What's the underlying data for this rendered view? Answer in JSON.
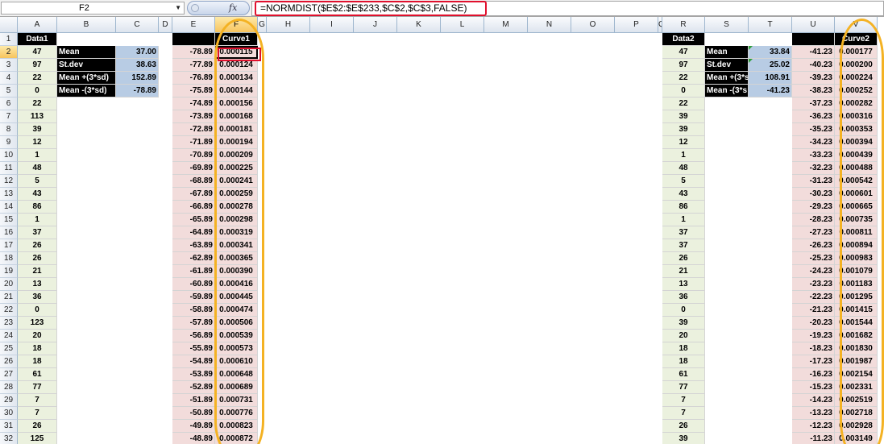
{
  "formula_bar": {
    "name_box": "F2",
    "fx_label": "fx",
    "formula": "=NORMDIST($E$2:$E$233,$C$2,$C$3,FALSE)"
  },
  "columns": [
    "A",
    "B",
    "C",
    "D",
    "E",
    "F",
    "G",
    "H",
    "I",
    "J",
    "K",
    "L",
    "M",
    "N",
    "O",
    "P",
    "Q",
    "R",
    "S",
    "T",
    "U",
    "V"
  ],
  "active_column": "F",
  "active_row": 2,
  "rows": [
    1,
    2,
    3,
    4,
    5,
    6,
    7,
    8,
    9,
    10,
    11,
    12,
    13,
    14,
    15,
    16,
    17,
    18,
    19,
    20,
    21,
    22,
    23,
    24,
    25,
    26,
    27,
    28,
    29,
    30,
    31,
    32
  ],
  "headers": {
    "A1": "Data1",
    "F1": "Curve1",
    "R1": "Data2",
    "V1": "Curve2"
  },
  "stats_left": [
    {
      "label": "Mean",
      "value": "37.00"
    },
    {
      "label": "St.dev",
      "value": "38.63"
    },
    {
      "label": "Mean +(3*sd)",
      "value": "152.89"
    },
    {
      "label": "Mean -(3*sd)",
      "value": "-78.89"
    }
  ],
  "stats_right": [
    {
      "label": "Mean",
      "value": "33.84"
    },
    {
      "label": "St.dev",
      "value": "25.02"
    },
    {
      "label": "Mean +(3*s",
      "value": "108.91"
    },
    {
      "label": "Mean -(3*s",
      "value": "-41.23"
    }
  ],
  "col_A": [
    "47",
    "97",
    "22",
    "0",
    "22",
    "113",
    "39",
    "12",
    "1",
    "48",
    "5",
    "43",
    "86",
    "1",
    "37",
    "26",
    "26",
    "21",
    "13",
    "36",
    "0",
    "123",
    "20",
    "18",
    "18",
    "61",
    "77",
    "7",
    "7",
    "26",
    "125"
  ],
  "col_E": [
    "-78.89",
    "-77.89",
    "-76.89",
    "-75.89",
    "-74.89",
    "-73.89",
    "-72.89",
    "-71.89",
    "-70.89",
    "-69.89",
    "-68.89",
    "-67.89",
    "-66.89",
    "-65.89",
    "-64.89",
    "-63.89",
    "-62.89",
    "-61.89",
    "-60.89",
    "-59.89",
    "-58.89",
    "-57.89",
    "-56.89",
    "-55.89",
    "-54.89",
    "-53.89",
    "-52.89",
    "-51.89",
    "-50.89",
    "-49.89",
    "-48.89"
  ],
  "col_F": [
    "0.000115",
    "0.000124",
    "0.000134",
    "0.000144",
    "0.000156",
    "0.000168",
    "0.000181",
    "0.000194",
    "0.000209",
    "0.000225",
    "0.000241",
    "0.000259",
    "0.000278",
    "0.000298",
    "0.000319",
    "0.000341",
    "0.000365",
    "0.000390",
    "0.000416",
    "0.000445",
    "0.000474",
    "0.000506",
    "0.000539",
    "0.000573",
    "0.000610",
    "0.000648",
    "0.000689",
    "0.000731",
    "0.000776",
    "0.000823",
    "0.000872"
  ],
  "col_R": [
    "47",
    "97",
    "22",
    "0",
    "22",
    "39",
    "39",
    "12",
    "1",
    "48",
    "5",
    "43",
    "86",
    "1",
    "37",
    "37",
    "26",
    "21",
    "13",
    "36",
    "0",
    "39",
    "20",
    "18",
    "18",
    "61",
    "77",
    "7",
    "7",
    "26",
    "39"
  ],
  "col_U": [
    "-41.23",
    "-40.23",
    "-39.23",
    "-38.23",
    "-37.23",
    "-36.23",
    "-35.23",
    "-34.23",
    "-33.23",
    "-32.23",
    "-31.23",
    "-30.23",
    "-29.23",
    "-28.23",
    "-27.23",
    "-26.23",
    "-25.23",
    "-24.23",
    "-23.23",
    "-22.23",
    "-21.23",
    "-20.23",
    "-19.23",
    "-18.23",
    "-17.23",
    "-16.23",
    "-15.23",
    "-14.23",
    "-13.23",
    "-12.23",
    "-11.23"
  ],
  "col_V": [
    "0.000177",
    "0.000200",
    "0.000224",
    "0.000252",
    "0.000282",
    "0.000316",
    "0.000353",
    "0.000394",
    "0.000439",
    "0.000488",
    "0.000542",
    "0.000601",
    "0.000665",
    "0.000735",
    "0.000811",
    "0.000894",
    "0.000983",
    "0.001079",
    "0.001183",
    "0.001295",
    "0.001415",
    "0.001544",
    "0.001682",
    "0.001830",
    "0.001987",
    "0.002154",
    "0.002331",
    "0.002519",
    "0.002718",
    "0.002928",
    "0.003149"
  ],
  "colors": {
    "green_fill": "#ebf1de",
    "pink_fill": "#f2dcdb",
    "blue_fill": "#b8cce4",
    "black_fill": "#000000",
    "highlight_red": "#e0102d",
    "highlight_orange": "#f4b223",
    "header_active": "#f7c45d"
  }
}
